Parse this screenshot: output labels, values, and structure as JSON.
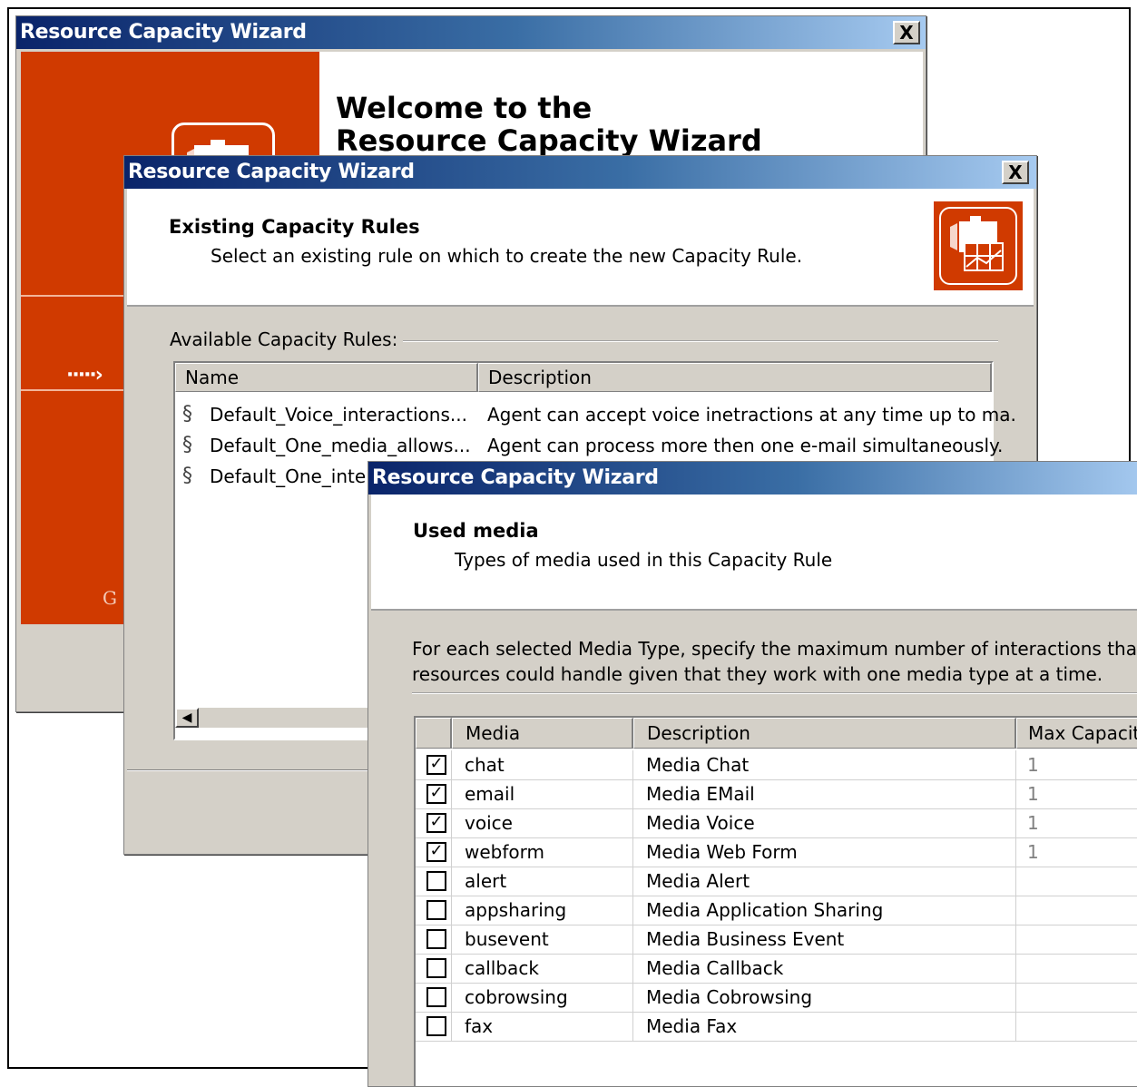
{
  "window1": {
    "title": "Resource Capacity Wizard",
    "close_label": "X",
    "welcome_line1": "Welcome to the",
    "welcome_line2": "Resource Capacity Wizard",
    "sidebar_letter": "G"
  },
  "window2": {
    "title": "Resource Capacity Wizard",
    "close_label": "X",
    "header_title": "Existing Capacity Rules",
    "header_subtitle": "Select an existing rule on which to create the new Capacity Rule.",
    "section_label": "Available Capacity Rules:",
    "columns": [
      "Name",
      "Description"
    ],
    "rules": [
      {
        "name": "Default_Voice_interactions...",
        "description": "Agent can accept voice inetractions at any time up to ma."
      },
      {
        "name": "Default_One_media_allows...",
        "description": "Agent can process more then one e-mail simultaneously."
      },
      {
        "name": "Default_One_inte",
        "description": ""
      }
    ],
    "scroll_left_label": "◀"
  },
  "window3": {
    "title": "Resource Capacity Wizard",
    "header_title": "Used media",
    "header_subtitle": "Types of media used in this Capacity Rule",
    "instruction_line1": "For each selected Media Type, specify the maximum number of interactions that com",
    "instruction_line2": "resources could handle given that they work with one media type at a time.",
    "columns": [
      "",
      "Media",
      "Description",
      "Max Capacit"
    ],
    "media": [
      {
        "checked": true,
        "media": "chat",
        "description": "Media Chat",
        "max_capacity": "1"
      },
      {
        "checked": true,
        "media": "email",
        "description": "Media EMail",
        "max_capacity": "1"
      },
      {
        "checked": true,
        "media": "voice",
        "description": "Media Voice",
        "max_capacity": "1"
      },
      {
        "checked": true,
        "media": "webform",
        "description": "Media Web Form",
        "max_capacity": "1"
      },
      {
        "checked": false,
        "media": "alert",
        "description": "Media Alert",
        "max_capacity": ""
      },
      {
        "checked": false,
        "media": "appsharing",
        "description": "Media Application Sharing",
        "max_capacity": ""
      },
      {
        "checked": false,
        "media": "busevent",
        "description": "Media Business Event",
        "max_capacity": ""
      },
      {
        "checked": false,
        "media": "callback",
        "description": "Media Callback",
        "max_capacity": ""
      },
      {
        "checked": false,
        "media": "cobrowsing",
        "description": "Media Cobrowsing",
        "max_capacity": ""
      },
      {
        "checked": false,
        "media": "fax",
        "description": "Media Fax",
        "max_capacity": ""
      }
    ],
    "check_mark": "✓"
  },
  "colors": {
    "brand_orange": "#d03a00",
    "title_gradient_start": "#0a246a",
    "title_gradient_end": "#a6caf0",
    "dialog_gray": "#d4d0c8"
  },
  "icons": [
    "close-icon",
    "wizard-logo-icon",
    "arrow-right-icon",
    "rule-link-icon",
    "scroll-left-icon",
    "checkbox-icon"
  ]
}
